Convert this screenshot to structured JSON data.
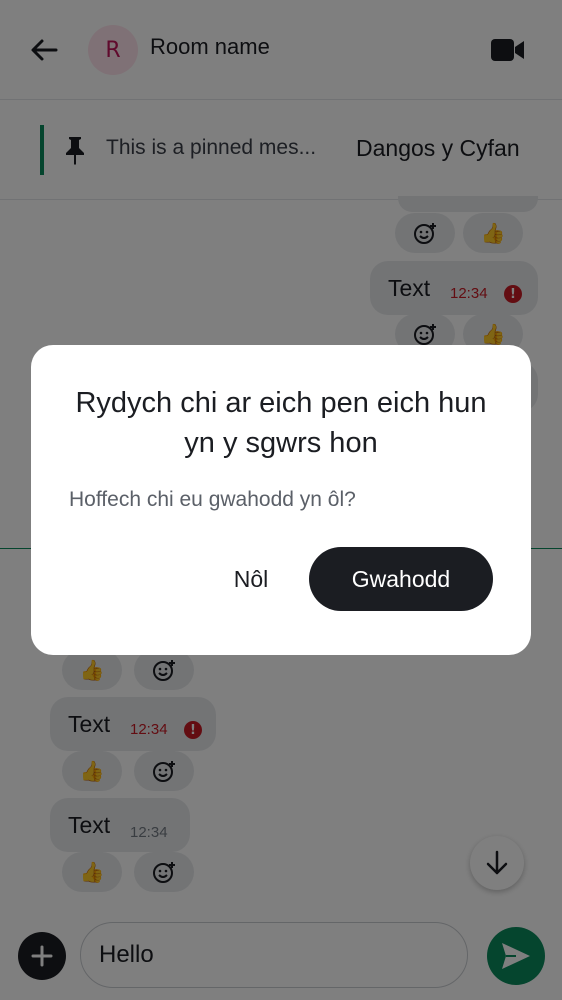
{
  "header": {
    "back_icon": "arrow-left-icon",
    "avatar_letter": "R",
    "room_name": "Room name",
    "video_icon": "video-camera-icon"
  },
  "pinned": {
    "text": "This is a pinned mes...",
    "show_all": "Dangos y Cyfan",
    "icon": "pin-icon"
  },
  "timeline": {
    "outgoing": [
      {
        "text": "Text",
        "time": "12:34",
        "error": true
      }
    ],
    "incoming": [
      {
        "text": "Text",
        "time": "12:34",
        "error": true
      },
      {
        "text": "Text",
        "time": "12:34",
        "error": false
      }
    ],
    "reaction_thumbs": "👍",
    "error_mark": "!"
  },
  "composer": {
    "value": "Hello",
    "plus_icon": "plus-icon",
    "send_icon": "send-icon"
  },
  "dialog": {
    "title": "Rydych chi ar eich pen eich hun yn y sgwrs hon",
    "body": "Hoffech chi eu gwahodd yn ôl?",
    "back_label": "Nôl",
    "invite_label": "Gwahodd"
  },
  "colors": {
    "accent": "#0b8a5c",
    "error": "#c71b24",
    "primary_button": "#1b1d22"
  }
}
